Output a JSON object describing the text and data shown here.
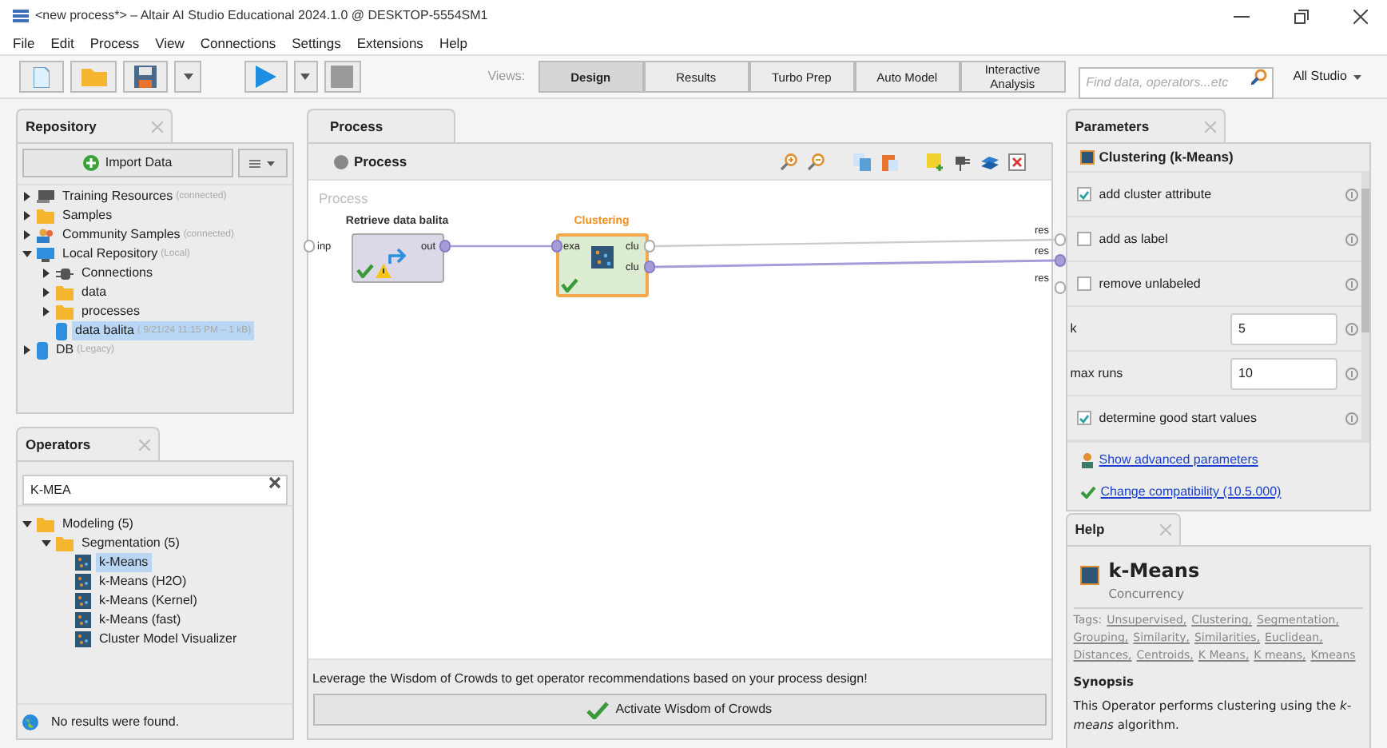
{
  "window": {
    "title": "<new process*> – Altair AI Studio Educational 2024.1.0 @ DESKTOP-5554SM1"
  },
  "menu": [
    "File",
    "Edit",
    "Process",
    "View",
    "Connections",
    "Settings",
    "Extensions",
    "Help"
  ],
  "views": {
    "label": "Views:",
    "tabs": [
      {
        "label": "Design",
        "selected": true
      },
      {
        "label": "Results",
        "selected": false
      },
      {
        "label": "Turbo Prep",
        "selected": false
      },
      {
        "label": "Auto Model",
        "selected": false
      },
      {
        "label": "Interactive Analysis",
        "selected": false
      }
    ]
  },
  "search": {
    "placeholder": "Find data, operators...etc"
  },
  "studio_menu": "All Studio",
  "repository": {
    "title": "Repository",
    "import_button": "Import Data",
    "items": [
      {
        "label": "Training Resources",
        "note": "(connected)",
        "kind": "server",
        "expanded": false,
        "selected": false
      },
      {
        "label": "Samples",
        "kind": "folder",
        "expanded": false,
        "selected": false
      },
      {
        "label": "Community Samples",
        "note": "(connected)",
        "kind": "people",
        "expanded": false,
        "selected": false
      },
      {
        "label": "Local Repository",
        "note": "(Local)",
        "kind": "monitor",
        "expanded": true,
        "selected": false,
        "children": [
          {
            "label": "Connections",
            "kind": "plug",
            "expanded": false,
            "selected": false
          },
          {
            "label": "data",
            "kind": "folder",
            "expanded": false,
            "selected": false
          },
          {
            "label": "processes",
            "kind": "folder",
            "expanded": false,
            "selected": false
          },
          {
            "label": "data balita",
            "note": "( 9/21/24 11:15 PM – 1 kB)",
            "kind": "dataset",
            "selected": true
          }
        ]
      },
      {
        "label": "DB",
        "note": "(Legacy)",
        "kind": "database",
        "expanded": false,
        "selected": false
      }
    ]
  },
  "operators": {
    "title": "Operators",
    "search_value": "K-MEA",
    "items": [
      {
        "label": "Modeling (5)",
        "kind": "folder",
        "expanded": true,
        "selected": false,
        "children": [
          {
            "label": "Segmentation (5)",
            "kind": "folder",
            "expanded": true,
            "selected": false,
            "children": [
              {
                "label": "k-Means",
                "kind": "operator",
                "selected": true
              },
              {
                "label": "k-Means (H2O)",
                "kind": "operator",
                "selected": false
              },
              {
                "label": "k-Means (Kernel)",
                "kind": "operator",
                "selected": false
              },
              {
                "label": "k-Means (fast)",
                "kind": "operator",
                "selected": false
              },
              {
                "label": "Cluster Model Visualizer",
                "kind": "operator",
                "selected": false
              }
            ]
          }
        ]
      }
    ],
    "status": "No results were found."
  },
  "process": {
    "tab": "Process",
    "breadcrumb": "Process",
    "canvas_label": "Process",
    "input_ports": [
      {
        "label": "inp",
        "connected": false
      }
    ],
    "operators": [
      {
        "title": "Retrieve data balita",
        "kind": "retrieve",
        "highlighted": false,
        "warning": true,
        "out": [
          {
            "label": "out",
            "connected": true
          }
        ]
      },
      {
        "title": "Clustering",
        "kind": "clustering",
        "highlighted": true,
        "warning": false,
        "in": [
          {
            "label": "exa",
            "connected": true
          }
        ],
        "out": [
          {
            "label": "clu",
            "connected": false
          },
          {
            "label": "clu",
            "connected": true
          }
        ]
      }
    ],
    "output_ports": [
      {
        "label": "res",
        "connected": false
      },
      {
        "label": "res",
        "connected": true
      },
      {
        "label": "res",
        "connected": false
      }
    ],
    "wisdom_text": "Leverage the Wisdom of Crowds to get operator recommendations based on your process design!",
    "wisdom_button": "Activate Wisdom of Crowds"
  },
  "parameters": {
    "title": "Parameters",
    "operator": "Clustering (k-Means)",
    "items": [
      {
        "kind": "checkbox",
        "label": "add cluster attribute",
        "checked": true
      },
      {
        "kind": "checkbox",
        "label": "add as label",
        "checked": false
      },
      {
        "kind": "checkbox",
        "label": "remove unlabeled",
        "checked": false
      },
      {
        "kind": "number",
        "label": "k",
        "value": "5"
      },
      {
        "kind": "number",
        "label": "max runs",
        "value": "10"
      },
      {
        "kind": "checkbox",
        "label": "determine good start values",
        "checked": true
      }
    ],
    "advanced_link": "Show advanced parameters",
    "compat_link": "Change compatibility (10.5.000)"
  },
  "help": {
    "title": "Help",
    "name": "k-Means",
    "group": "Concurrency",
    "tags_label": "Tags:",
    "tags": [
      "Unsupervised,",
      "Clustering,",
      "Segmentation,",
      "Grouping,",
      "Similarity,",
      "Similarities,",
      "Euclidean,",
      "Distances,",
      "Centroids,",
      "K Means,",
      "K means,",
      "Kmeans"
    ],
    "synopsis_title": "Synopsis",
    "synopsis": "This Operator performs clustering using the *k-means* algorithm."
  }
}
